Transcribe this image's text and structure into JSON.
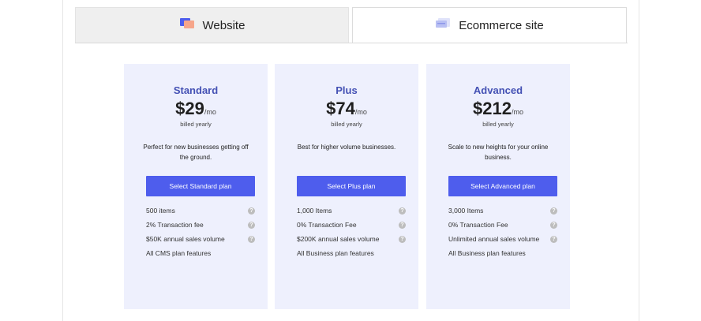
{
  "tabs": {
    "website_label": "Website",
    "ecommerce_label": "Ecommerce site",
    "active": "website"
  },
  "colors": {
    "accent": "#4e5ded",
    "plan_title": "#4451b4",
    "card_bg": "#eef0fd"
  },
  "plans": [
    {
      "name": "Standard",
      "price": "$29",
      "per": "/mo",
      "billing": "billed yearly",
      "description": "Perfect for new businesses getting off the ground.",
      "button_label": "Select Standard plan",
      "features": [
        {
          "text": "500 items",
          "help": true
        },
        {
          "text": "2% Transaction fee",
          "help": true
        },
        {
          "text": "$50K annual sales volume",
          "help": true
        },
        {
          "text": "All CMS plan features",
          "help": false
        }
      ]
    },
    {
      "name": "Plus",
      "price": "$74",
      "per": "/mo",
      "billing": "billed yearly",
      "description": "Best for higher volume businesses.",
      "button_label": "Select Plus plan",
      "features": [
        {
          "text": "1,000 Items",
          "help": true
        },
        {
          "text": "0% Transaction Fee",
          "help": true
        },
        {
          "text": "$200K annual sales volume",
          "help": true
        },
        {
          "text": "All Business plan features",
          "help": false
        }
      ]
    },
    {
      "name": "Advanced",
      "price": "$212",
      "per": "/mo",
      "billing": "billed yearly",
      "description": "Scale to new heights for your online business.",
      "button_label": "Select Advanced plan",
      "features": [
        {
          "text": "3,000 Items",
          "help": true
        },
        {
          "text": "0% Transaction Fee",
          "help": true
        },
        {
          "text": "Unlimited annual sales volume",
          "help": true
        },
        {
          "text": "All Business plan features",
          "help": false
        }
      ]
    }
  ]
}
